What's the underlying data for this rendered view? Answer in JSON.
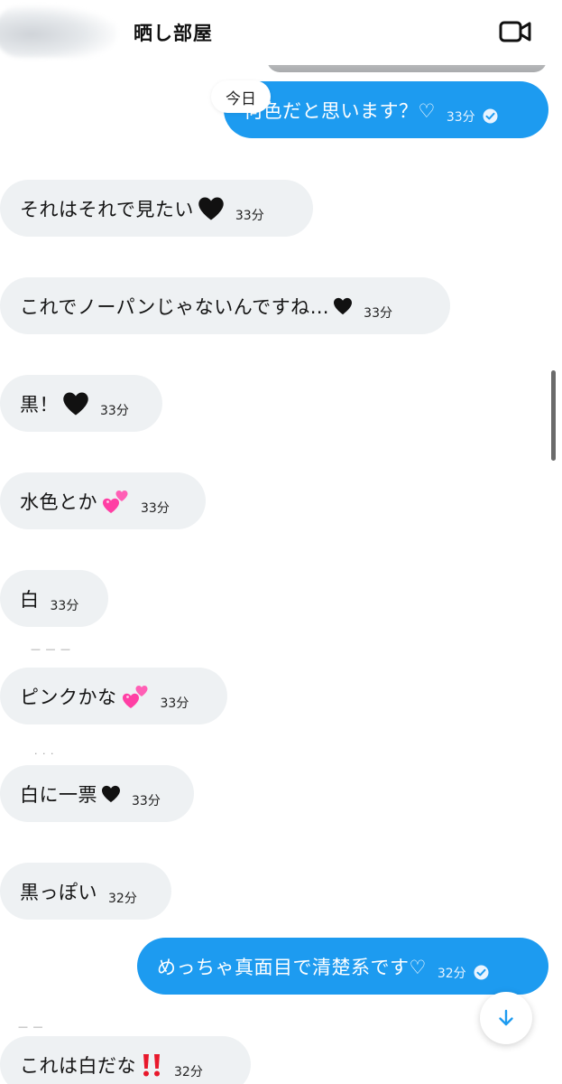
{
  "header": {
    "title": "晒し部屋",
    "video_icon": "video-camera-icon"
  },
  "date_chip": "今日",
  "messages": [
    {
      "side": "out",
      "text": "何色だと思います？♡",
      "time": "33分",
      "read": true
    },
    {
      "side": "in",
      "text": "それはそれで見たい",
      "emoji": "black-heart",
      "time": "33分"
    },
    {
      "side": "in",
      "text": "これでノーパンじゃないんですね…",
      "emoji": "small-black-heart",
      "time": "33分"
    },
    {
      "side": "in",
      "text": "黒！",
      "emoji": "black-heart",
      "time": "33分"
    },
    {
      "side": "in",
      "text": "水色とか",
      "emoji": "two-hearts",
      "time": "33分"
    },
    {
      "side": "in",
      "text": "白",
      "time": "33分"
    },
    {
      "side": "in",
      "text": "ピンクかな",
      "emoji": "two-hearts",
      "time": "33分"
    },
    {
      "side": "in",
      "text": "白に一票",
      "emoji": "small-black-heart",
      "time": "33分"
    },
    {
      "side": "in",
      "text": "黒っぽい",
      "time": "32分"
    },
    {
      "side": "out",
      "text": "めっちゃ真面目で清楚系です♡",
      "time": "32分",
      "read": true
    },
    {
      "side": "in",
      "text": "これは白だな",
      "emoji": "double-exclamation",
      "time": "32分"
    }
  ],
  "icons": {
    "read_check": "check-circle-icon",
    "scroll_down": "arrow-down-icon"
  },
  "colors": {
    "outgoing_bubble": "#1d9bf0",
    "incoming_bubble": "#eef1f3"
  }
}
